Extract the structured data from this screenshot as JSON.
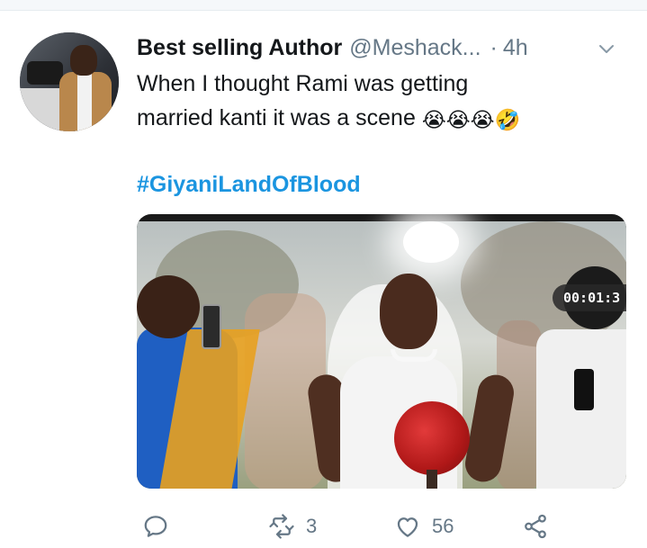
{
  "tweet": {
    "author_name": "Best selling Author",
    "handle": "@Meshack...",
    "separator": "·",
    "time": "4h",
    "text_line1": "When I thought Rami was getting",
    "text_line2": "married kanti it was a scene",
    "emojis": [
      "😭",
      "😭",
      "😭",
      "🤣"
    ],
    "hashtag": "#GiyaniLandOfBlood"
  },
  "media": {
    "video_timer": "00:01:3"
  },
  "actions": {
    "retweet_count": "3",
    "like_count": "56"
  },
  "colors": {
    "link": "#1b95e0",
    "secondary": "#657786",
    "text": "#14171a"
  },
  "icons": [
    "chevron-down-icon",
    "reply-icon",
    "retweet-icon",
    "heart-icon",
    "share-icon"
  ]
}
